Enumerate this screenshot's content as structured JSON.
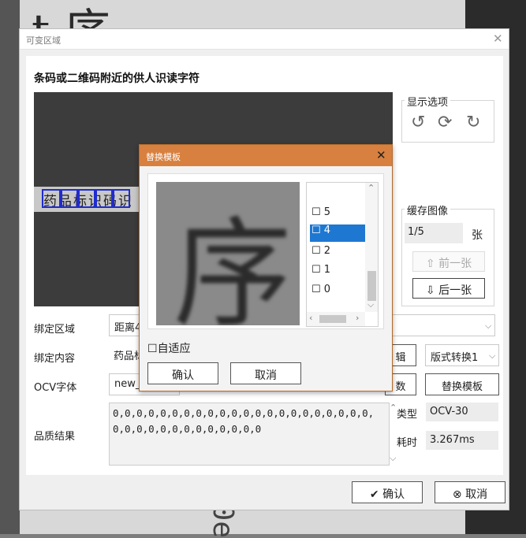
{
  "background": {
    "top_glyph": "t 序",
    "bottom_text": "30e"
  },
  "dialog": {
    "title": "可变区域",
    "heading": "条码或二维码附近的供人识读字符",
    "preview_text": "药品标识码识",
    "display_options": {
      "label": "显示选项",
      "icons": [
        "rotate-ccw-icon",
        "refresh-icon",
        "rotate-cw-icon"
      ]
    },
    "cache": {
      "label": "缓存图像",
      "count": "1/5",
      "unit": "张",
      "prev": "前一张",
      "next": "后一张"
    },
    "rows": {
      "bind_area": {
        "label": "绑定区域",
        "value": "距离4"
      },
      "bind_content": {
        "label": "绑定内容",
        "value": "药品标",
        "edit": "辑",
        "format": "版式转换1"
      },
      "ocv_font": {
        "label": "OCV字体",
        "value": "new_",
        "param": "数",
        "replace": "替换模板"
      }
    },
    "quality": {
      "label": "品质结果",
      "text": "0,0,0,0,0,0,0,0,0,0,0,0,0,0,0,0,0,0,0,0,0,0,0,0,0,0,0,0,0,0,0,0,0,0,0",
      "type_label": "类型",
      "type_value": "OCV-30",
      "time_label": "耗时",
      "time_value": "3.267ms"
    },
    "ok": "确认",
    "cancel": "取消"
  },
  "popup": {
    "title": "替换模板",
    "template_glyph": "序",
    "items": [
      "5",
      "4",
      "2",
      "1",
      "0"
    ],
    "selected": "4",
    "autofit": "自适应",
    "ok": "确认",
    "cancel": "取消"
  }
}
